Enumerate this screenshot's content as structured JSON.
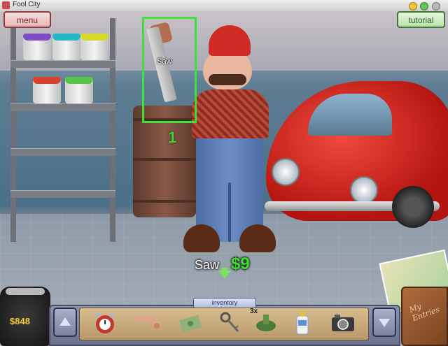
{
  "window": {
    "title": "Fool City"
  },
  "buttons": {
    "menu_label": "menu",
    "tutorial_label": "tutorial"
  },
  "hotspot": {
    "label": "Saw",
    "count": "1"
  },
  "price": {
    "item": "Saw",
    "amount": "$9"
  },
  "wallet": {
    "money": "$848"
  },
  "inventory": {
    "label": "inventory",
    "items": [
      {
        "name": "alarm-clock",
        "count": ""
      },
      {
        "name": "pipe-tool",
        "count": ""
      },
      {
        "name": "banknote",
        "count": ""
      },
      {
        "name": "keys",
        "count": ""
      },
      {
        "name": "green-gadget",
        "count": "3x"
      },
      {
        "name": "soap-bottle",
        "count": ""
      },
      {
        "name": "camera",
        "count": ""
      }
    ]
  },
  "journal": {
    "line1": "My",
    "line2": "Entries"
  },
  "colors": {
    "highlight": "#3ee03a",
    "price": "#3be028",
    "money": "#f4c631",
    "menu": "#e7b6b6",
    "tutorial": "#bde2ae"
  }
}
